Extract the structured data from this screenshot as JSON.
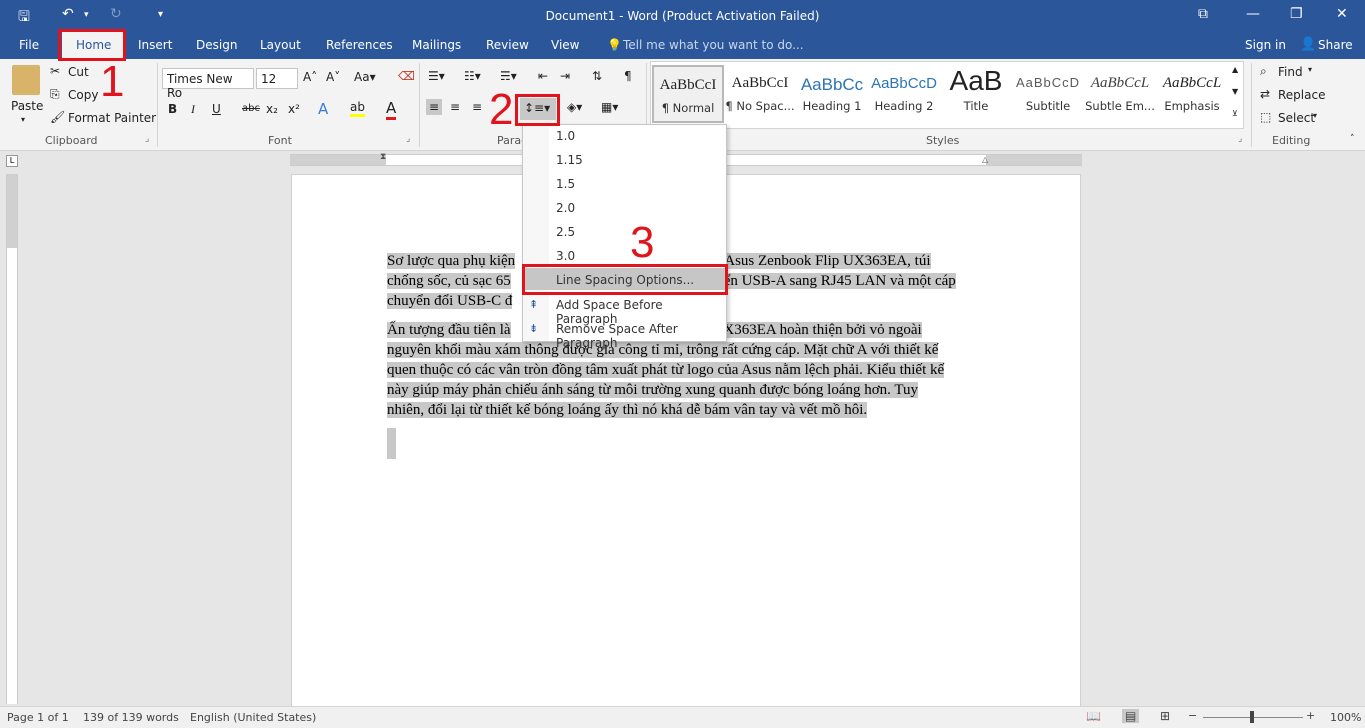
{
  "titlebar": {
    "title": "Document1 - Word (Product Activation Failed)"
  },
  "tabs": [
    "File",
    "Home",
    "Insert",
    "Design",
    "Layout",
    "References",
    "Mailings",
    "Review",
    "View"
  ],
  "tell_me": "Tell me what you want to do...",
  "sign_in": "Sign in",
  "share": "Share",
  "clipboard": {
    "paste": "Paste",
    "cut": "Cut",
    "copy": "Copy",
    "format_painter": "Format Painter",
    "label": "Clipboard"
  },
  "font": {
    "name": "Times New Ro",
    "size": "12",
    "label": "Font",
    "bold": "B",
    "italic": "I",
    "underline": "U",
    "strike": "abc",
    "sub": "x₂",
    "sup": "x²"
  },
  "paragraph": {
    "label": "Parag"
  },
  "styles": {
    "label": "Styles",
    "items": [
      {
        "preview": "AaBbCcI",
        "name": "¶ Normal"
      },
      {
        "preview": "AaBbCcI",
        "name": "¶ No Spac..."
      },
      {
        "preview": "AaBbCc",
        "name": "Heading 1"
      },
      {
        "preview": "AaBbCcD",
        "name": "Heading 2"
      },
      {
        "preview": "AaB",
        "name": "Title"
      },
      {
        "preview": "AaBbCcD",
        "name": "Subtitle"
      },
      {
        "preview": "AaBbCcL",
        "name": "Subtle Em..."
      },
      {
        "preview": "AaBbCcL",
        "name": "Emphasis"
      }
    ]
  },
  "editing": {
    "find": "Find",
    "replace": "Replace",
    "select": "Select",
    "label": "Editing"
  },
  "menu": {
    "items": [
      "1.0",
      "1.15",
      "1.5",
      "2.0",
      "2.5",
      "3.0"
    ],
    "options": "Line Spacing Options...",
    "add_before": "Add Space Before Paragraph",
    "remove_after": "Remove Space After Paragraph"
  },
  "annotations": {
    "n1": "1",
    "n2": "2",
    "n3": "3"
  },
  "document": {
    "p1_l1a": "Sơ lược qua phụ kiện",
    "p1_l1b": "áy Asus Zenbook Flip UX363EA, túi",
    "p1_l2a": "chống sốc, củ sạc 65",
    "p1_l2b": "uyển USB-A sang RJ45 LAN và một cáp",
    "p1_l3": "chuyển đổi USB-C đ",
    "p2_l1a": "Ấn tượng đầu tiên là",
    "p2_l1b": "UX363EA hoàn thiện bởi vỏ ngoài",
    "p2_l2": "nguyên khối màu xám thông được gia công tỉ mỉ, trông rất cứng cáp. Mặt chữ A với thiết kế",
    "p2_l3": "quen thuộc có các vân tròn đồng tâm xuất phát từ logo của Asus nằm lệch phải. Kiểu thiết kế",
    "p2_l4": "này giúp máy phản chiếu ánh sáng từ môi trường xung quanh được bóng loáng hơn. Tuy",
    "p2_l5": "nhiên, đổi lại từ thiết kế bóng loáng ấy thì nó khá dễ bám vân tay và vết mồ hôi."
  },
  "status": {
    "page": "Page 1 of 1",
    "words": "139 of 139 words",
    "lang": "English (United States)",
    "zoom": "100%"
  }
}
